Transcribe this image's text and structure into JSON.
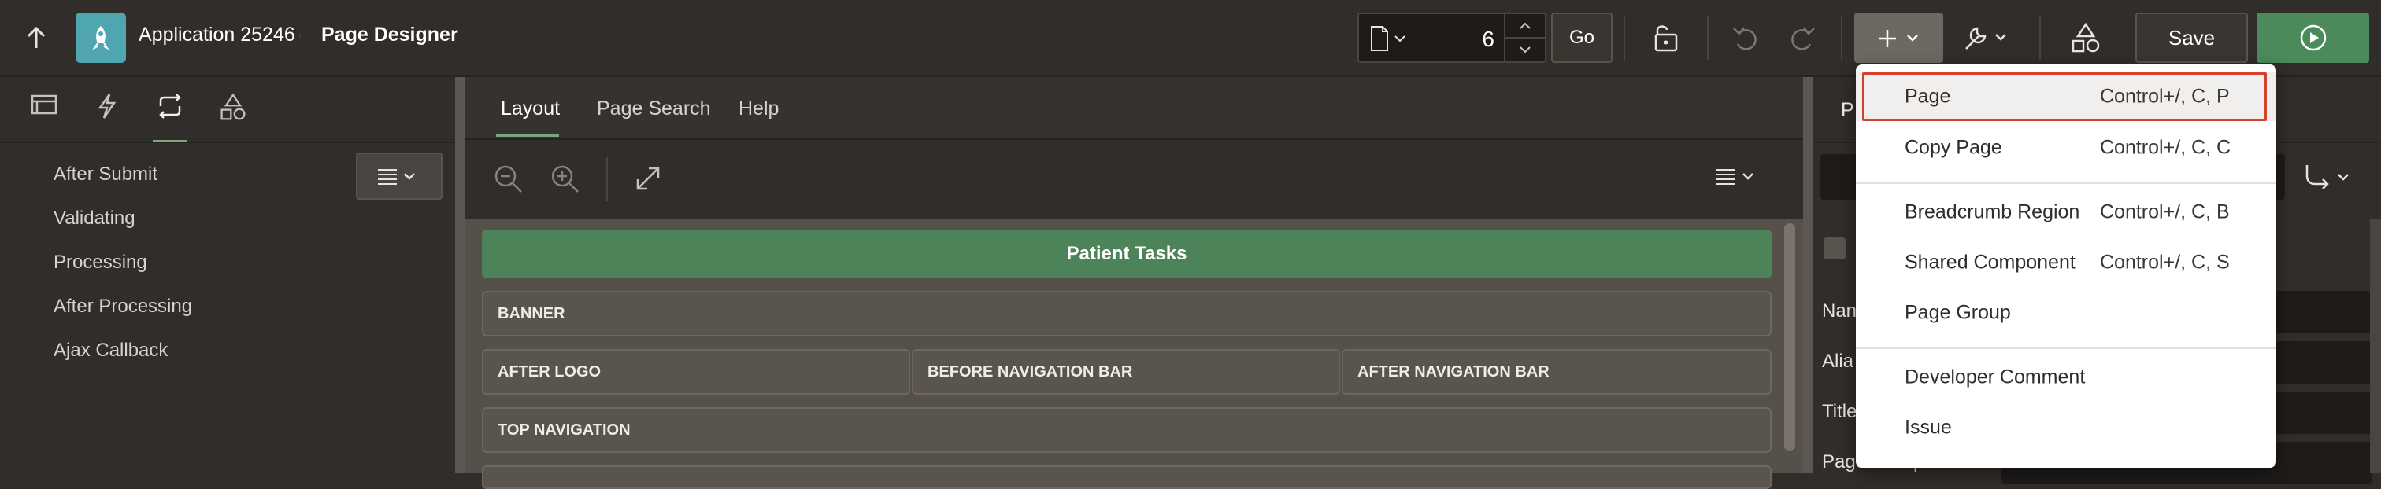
{
  "header": {
    "app_title": "Application 25246",
    "page_title": "Page Designer",
    "page_number": "6",
    "go_label": "Go",
    "save_label": "Save"
  },
  "left_pane": {
    "tree_items": [
      "After Submit",
      "Validating",
      "Processing",
      "After Processing",
      "Ajax Callback"
    ]
  },
  "center": {
    "tabs": [
      "Layout",
      "Page Search",
      "Help"
    ],
    "active_tab": "Layout",
    "regions": {
      "title_bar": "Patient Tasks",
      "banner": "BANNER",
      "after_logo": "AFTER LOGO",
      "before_nav": "BEFORE NAVIGATION BAR",
      "after_nav": "AFTER NAVIGATION BAR",
      "top_nav": "TOP NAVIGATION"
    }
  },
  "right_pane": {
    "tab_partial": "P",
    "labels": [
      "Nan",
      "Alia",
      "Title",
      "Page Group"
    ]
  },
  "create_menu": {
    "items": [
      {
        "label": "Page",
        "shortcut": "Control+/, C, P"
      },
      {
        "label": "Copy Page",
        "shortcut": "Control+/, C, C"
      },
      {
        "label": "Breadcrumb Region",
        "shortcut": "Control+/, C, B"
      },
      {
        "label": "Shared Component",
        "shortcut": "Control+/, C, S"
      },
      {
        "label": "Page Group",
        "shortcut": ""
      },
      {
        "label": "Developer Comment",
        "shortcut": ""
      },
      {
        "label": "Issue",
        "shortcut": ""
      }
    ]
  },
  "colors": {
    "accent_green": "#4c8a5c",
    "app_logo": "#4fa5b0",
    "highlight_outline": "#d3402c"
  }
}
